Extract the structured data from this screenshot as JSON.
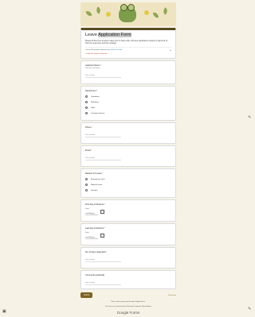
{
  "form": {
    "title_prefix": "Leave ",
    "title_highlight": "Application Form",
    "description": "Please fill this form at least 2 days prior to leave start. All leave applications subject to approval by both the supervisor and the manager.",
    "account": "contact@examplecompany.com",
    "switch_account": "Switch account",
    "required_note": "* Indicates required question"
  },
  "questions": {
    "applicant": {
      "label": "Applicant Name",
      "sub": "First and Last Name",
      "placeholder": "Your answer"
    },
    "department": {
      "label": "Department",
      "options": [
        "Operations",
        "Marketing",
        "Sales",
        "Customer Service"
      ]
    },
    "phone": {
      "label": "Phone",
      "placeholder": "Your answer"
    },
    "email": {
      "label": "Email",
      "placeholder": "Your answer"
    },
    "reason": {
      "label": "Reason for Leave",
      "options": [
        "Emergency Leave",
        "Medical Leave",
        "Vacation"
      ]
    },
    "first_day": {
      "label": "First day of Absence",
      "date_label": "Date",
      "value": "mm/dd/yyyy"
    },
    "last_day": {
      "label": "Last day of Absence",
      "date_label": "Date",
      "value": "mm/dd/yyyy"
    },
    "days_requested": {
      "label": "No. of days requested",
      "placeholder": "Your answer"
    },
    "comments": {
      "label": "Comments (optional)",
      "placeholder": "Your answer"
    }
  },
  "footer": {
    "submit": "Submit",
    "clear": "Clear form",
    "never_submit": "Never submit passwords through Google Forms.",
    "terms": "This form was created inside of Example Company. Report Abuse",
    "brand": "Google Forms"
  },
  "icons": {
    "cloud": "cloud-off-icon",
    "edit": "edit-icon"
  }
}
